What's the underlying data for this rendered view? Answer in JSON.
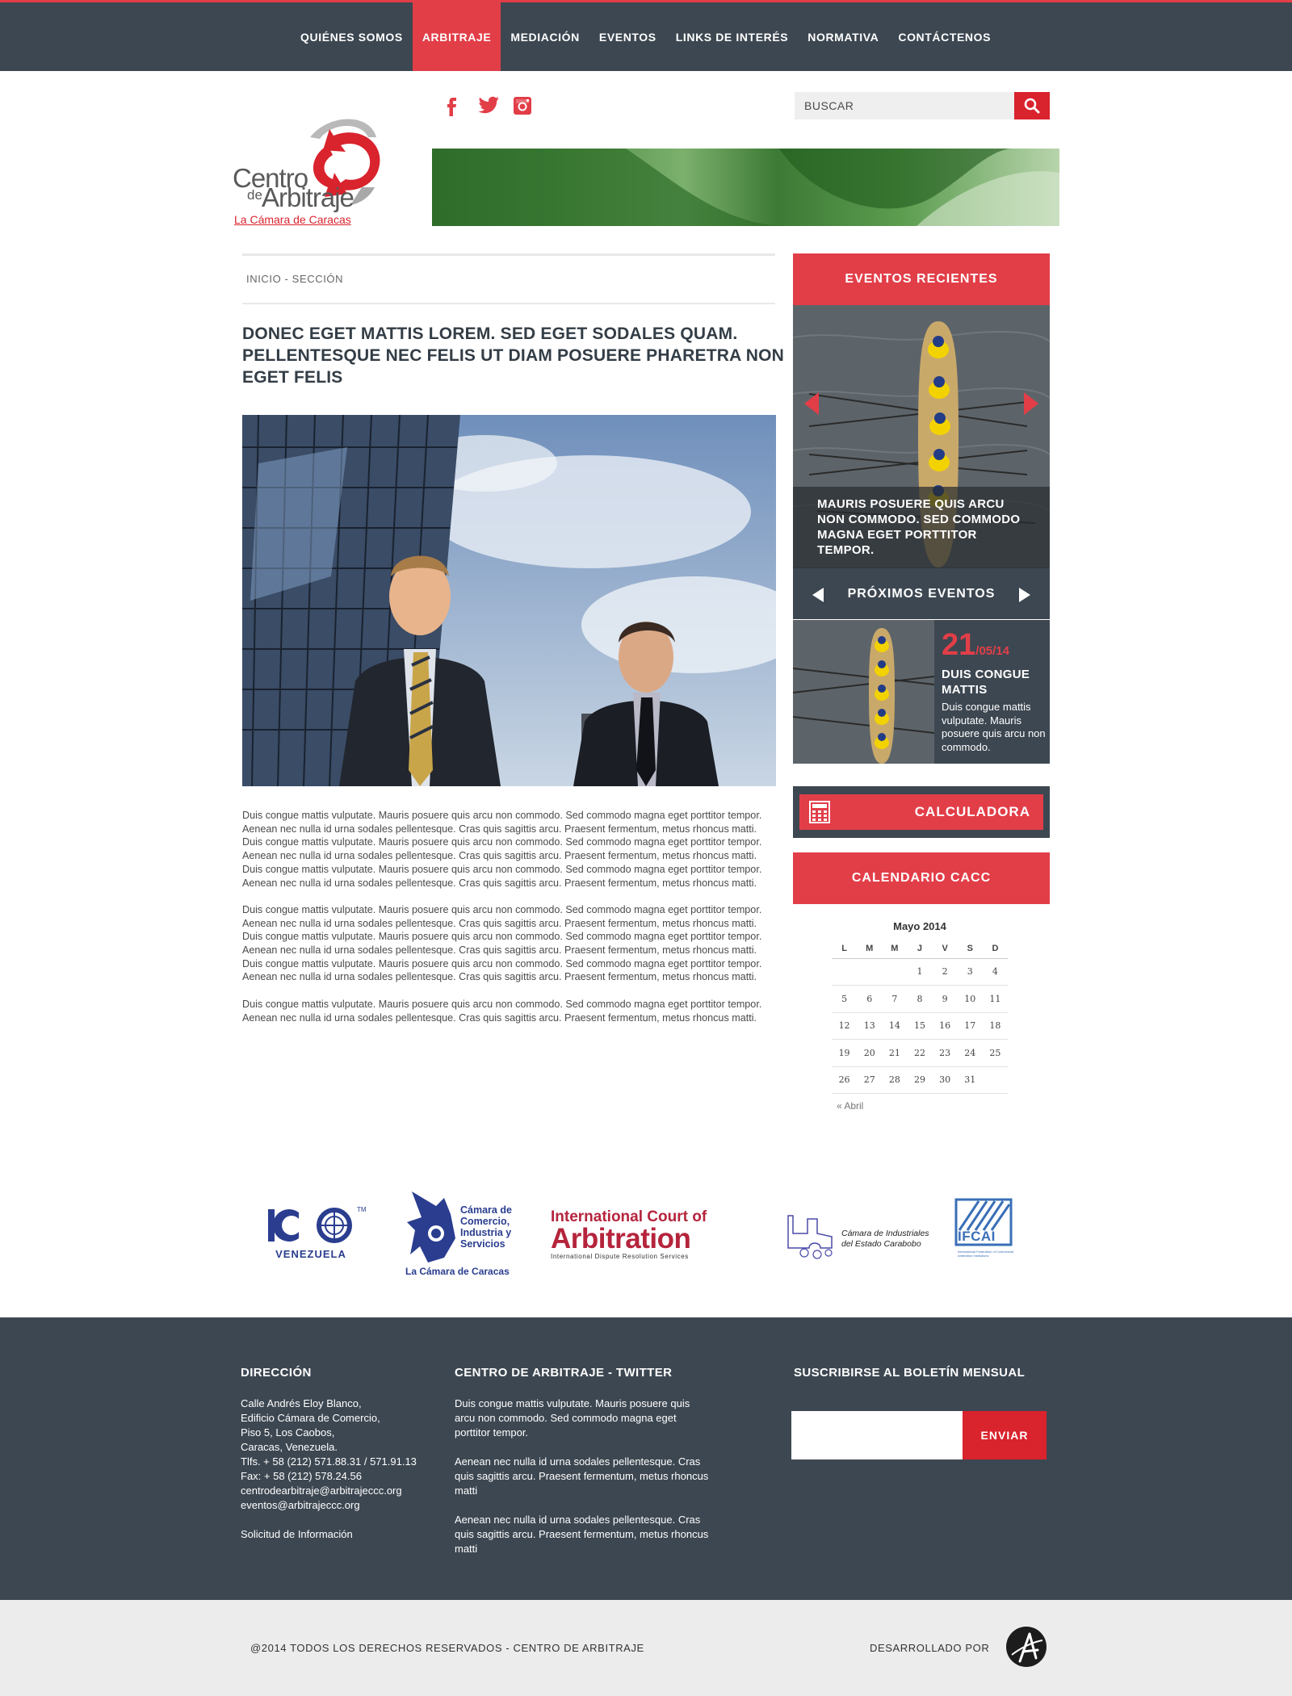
{
  "nav": {
    "items": [
      "QUIÉNES SOMOS",
      "ARBITRAJE",
      "MEDIACIÓN",
      "EVENTOS",
      "LINKS DE INTERÉS",
      "NORMATIVA",
      "CONTÁCTENOS"
    ],
    "active_index": 1
  },
  "header": {
    "social": [
      "facebook-icon",
      "twitter-icon",
      "instagram-icon"
    ],
    "search_placeholder": "BUSCAR",
    "logo": {
      "line1": "Centro",
      "line2": "de",
      "line3": "Arbitraje",
      "line4": "La Cámara de Caracas"
    }
  },
  "main": {
    "breadcrumb": "INICIO - SECCIÓN",
    "title": "DONEC EGET MATTIS LOREM. SED EGET SODALES QUAM. PELLENTESQUE NEC FELIS UT DIAM POSUERE PHARETRA NON EGET FELIS",
    "paragraphs": [
      "Duis congue mattis vulputate. Mauris posuere quis arcu non commodo. Sed commodo magna eget porttitor tempor. Aenean nec nulla id urna sodales pellentesque. Cras quis sagittis arcu. Praesent fermentum, metus rhoncus matti. Duis congue mattis vulputate. Mauris posuere quis arcu non commodo. Sed commodo magna eget porttitor tempor. Aenean nec nulla id urna sodales pellentesque. Cras quis sagittis arcu. Praesent fermentum, metus rhoncus matti. Duis congue mattis vulputate. Mauris posuere quis arcu non commodo. Sed commodo magna eget porttitor tempor. Aenean nec nulla id urna sodales pellentesque. Cras quis sagittis arcu. Praesent fermentum, metus rhoncus matti.",
      "Duis congue mattis vulputate. Mauris posuere quis arcu non commodo. Sed commodo magna eget porttitor tempor. Aenean nec nulla id urna sodales pellentesque. Cras quis sagittis arcu. Praesent fermentum, metus rhoncus matti.",
      "Duis congue mattis vulputate. Mauris posuere quis arcu non commodo. Sed commodo magna eget porttitor tempor. Aenean nec nulla id urna sodales pellentesque. Cras quis sagittis arcu. Praesent fermentum, metus rhoncus matti. Duis congue mattis vulputate. Mauris posuere quis arcu non commodo. Sed commodo magna eget porttitor tempor. Aenean nec nulla id urna sodales pellentesque. Cras quis sagittis arcu. Praesent fermentum, metus rhoncus matti.",
      "Duis congue mattis vulputate. Mauris posuere quis arcu non commodo. Sed commodo magna eget porttitor tempor. Aenean nec nulla id urna sodales pellentesque. Cras quis sagittis arcu. Praesent fermentum, metus rhoncus matti."
    ]
  },
  "sidebar": {
    "recent_title": "EVENTOS RECIENTES",
    "recent_caption": "MAURIS POSUERE QUIS ARCU NON COMMODO. SED COMMODO MAGNA EGET PORTTITOR TEMPOR.",
    "upcoming_title": "PRÓXIMOS EVENTOS",
    "upcoming": {
      "day": "21",
      "monthyear": "/05/14",
      "name": "DUIS CONGUE MATTIS",
      "desc": "Duis congue mattis vulputate. Mauris posuere quis arcu non commodo."
    },
    "calc_label": "CALCULADORA",
    "calendar_title": "CALENDARIO CACC",
    "calendar": {
      "caption": "Mayo 2014",
      "weekdays": [
        "L",
        "M",
        "M",
        "J",
        "V",
        "S",
        "D"
      ],
      "weeks": [
        [
          "",
          "",
          "",
          "1",
          "2",
          "3",
          "4"
        ],
        [
          "5",
          "6",
          "7",
          "8",
          "9",
          "10",
          "11"
        ],
        [
          "12",
          "13",
          "14",
          "15",
          "16",
          "17",
          "18"
        ],
        [
          "19",
          "20",
          "21",
          "22",
          "23",
          "24",
          "25"
        ],
        [
          "26",
          "27",
          "28",
          "29",
          "30",
          "31",
          ""
        ]
      ],
      "prev": "« Abril"
    }
  },
  "partners": {
    "icc": {
      "name": "ICC",
      "tm": "TM",
      "sub": "VENEZUELA"
    },
    "camara": {
      "l1": "Cámara de",
      "l2": "Comercio,",
      "l3": "Industria y",
      "l4": "Servicios",
      "l5": "La Cámara de Caracas"
    },
    "court": {
      "l1": "International Court of",
      "l2": "Arbitration",
      "l3": "International Dispute Resolution Services"
    },
    "carabobo": {
      "l1": "Cámara de Industriales",
      "l2": "del Estado Carabobo"
    },
    "ifcai": {
      "name": "IFCAI",
      "sub": "International Federation of Commercial Arbitration Institutions"
    }
  },
  "footer": {
    "address_title": "DIRECCIÓN",
    "address_lines": [
      "Calle Andrés Eloy Blanco,",
      "Edificio Cámara de Comercio,",
      "Piso 5, Los Caobos,",
      "Caracas, Venezuela.",
      "Tlfs. + 58 (212) 571.88.31 / 571.91.13",
      "Fax: + 58 (212) 578.24.56",
      "centrodearbitraje@arbitrajeccc.org",
      "eventos@arbitrajeccc.org"
    ],
    "info_link": "Solicitud de Información",
    "twitter_title": "CENTRO DE ARBITRAJE  - TWITTER",
    "tweets": [
      "Duis congue mattis vulputate. Mauris posuere quis arcu non commodo. Sed commodo magna eget porttitor tempor.",
      "Aenean nec nulla id urna sodales pellentesque. Cras quis sagittis arcu. Praesent fermentum, metus rhoncus matti",
      "Aenean nec nulla id urna sodales pellentesque. Cras quis sagittis arcu. Praesent fermentum, metus rhoncus matti"
    ],
    "newsletter_title": "SUSCRIBIRSE AL BOLETÍN MENSUAL",
    "send_label": "ENVIAR"
  },
  "bottom": {
    "copyright": "@2014 TODOS LOS DERECHOS RESERVADOS - CENTRO DE ARBITRAJE",
    "developed_by": "DESARROLLADO POR"
  },
  "colors": {
    "accent": "#e23e48",
    "dark": "#3d4751",
    "button_red": "#d9232d"
  }
}
